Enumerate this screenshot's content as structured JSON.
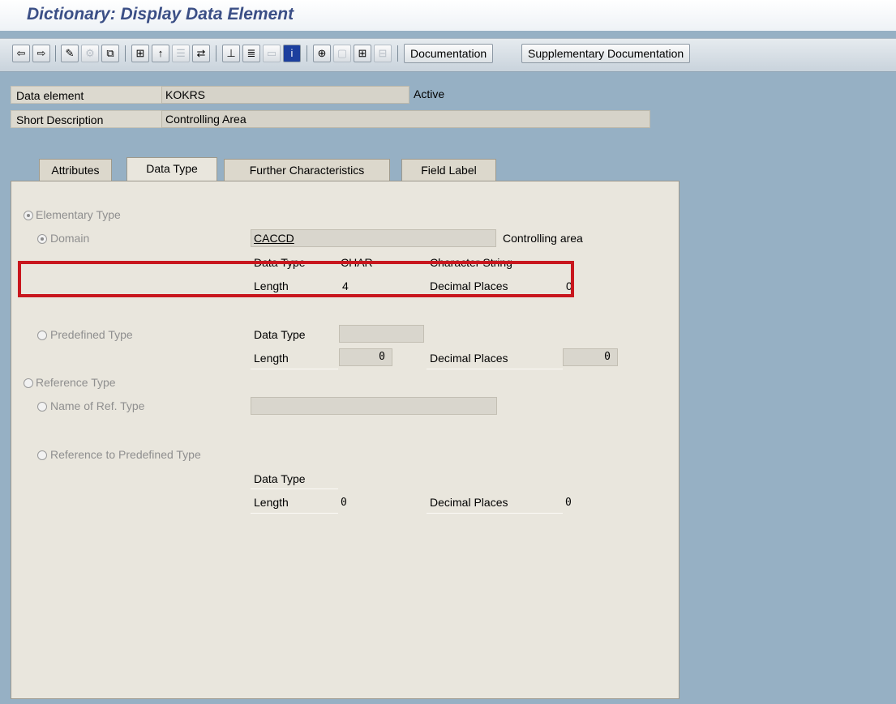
{
  "window": {
    "title": "Dictionary: Display Data Element"
  },
  "toolbar": {
    "icons": [
      "back-arrow-icon",
      "forward-arrow-icon",
      "display-change-icon",
      "activate-icon",
      "other-object-icon",
      "where-used-icon",
      "check-icon",
      "display-object-list-icon",
      "navigate-icon",
      "hierarchy-icon",
      "list-icon",
      "window-icon",
      "info-icon",
      "expand-icon",
      "collapse-icon",
      "select-all-icon",
      "deselect-icon"
    ],
    "documentation_label": "Documentation",
    "supplementary_label": "Supplementary Documentation"
  },
  "header": {
    "data_element_label": "Data element",
    "data_element_value": "KOKRS",
    "status": "Active",
    "short_desc_label": "Short Description",
    "short_desc_value": "Controlling Area"
  },
  "tabs": [
    {
      "label": "Attributes",
      "active": false
    },
    {
      "label": "Data Type",
      "active": true
    },
    {
      "label": "Further Characteristics",
      "active": false
    },
    {
      "label": "Field Label",
      "active": false
    }
  ],
  "data_type_tab": {
    "elementary_type_label": "Elementary Type",
    "domain_label": "Domain",
    "domain_value": "CACCD",
    "domain_desc": "Controlling area",
    "dom_data_type_label": "Data Type",
    "dom_data_type_value": "CHAR",
    "dom_data_type_desc": "Character String",
    "dom_length_label": "Length",
    "dom_length_value": "4",
    "dom_decimal_label": "Decimal Places",
    "dom_decimal_value": "0",
    "predefined_type_label": "Predefined Type",
    "pre_data_type_label": "Data Type",
    "pre_data_type_value": "",
    "pre_length_label": "Length",
    "pre_length_value": "0",
    "pre_decimal_label": "Decimal Places",
    "pre_decimal_value": "0",
    "reference_type_label": "Reference Type",
    "ref_name_label": "Name of Ref. Type",
    "ref_name_value": "",
    "ref_predef_label": "Reference to Predefined Type",
    "ref_data_type_label": "Data Type",
    "ref_length_label": "Length",
    "ref_length_value": "0",
    "ref_decimal_label": "Decimal Places",
    "ref_decimal_value": "0"
  },
  "colors": {
    "highlight": "#c8161d",
    "title": "#3b4f86",
    "background": "#96b0c4"
  }
}
